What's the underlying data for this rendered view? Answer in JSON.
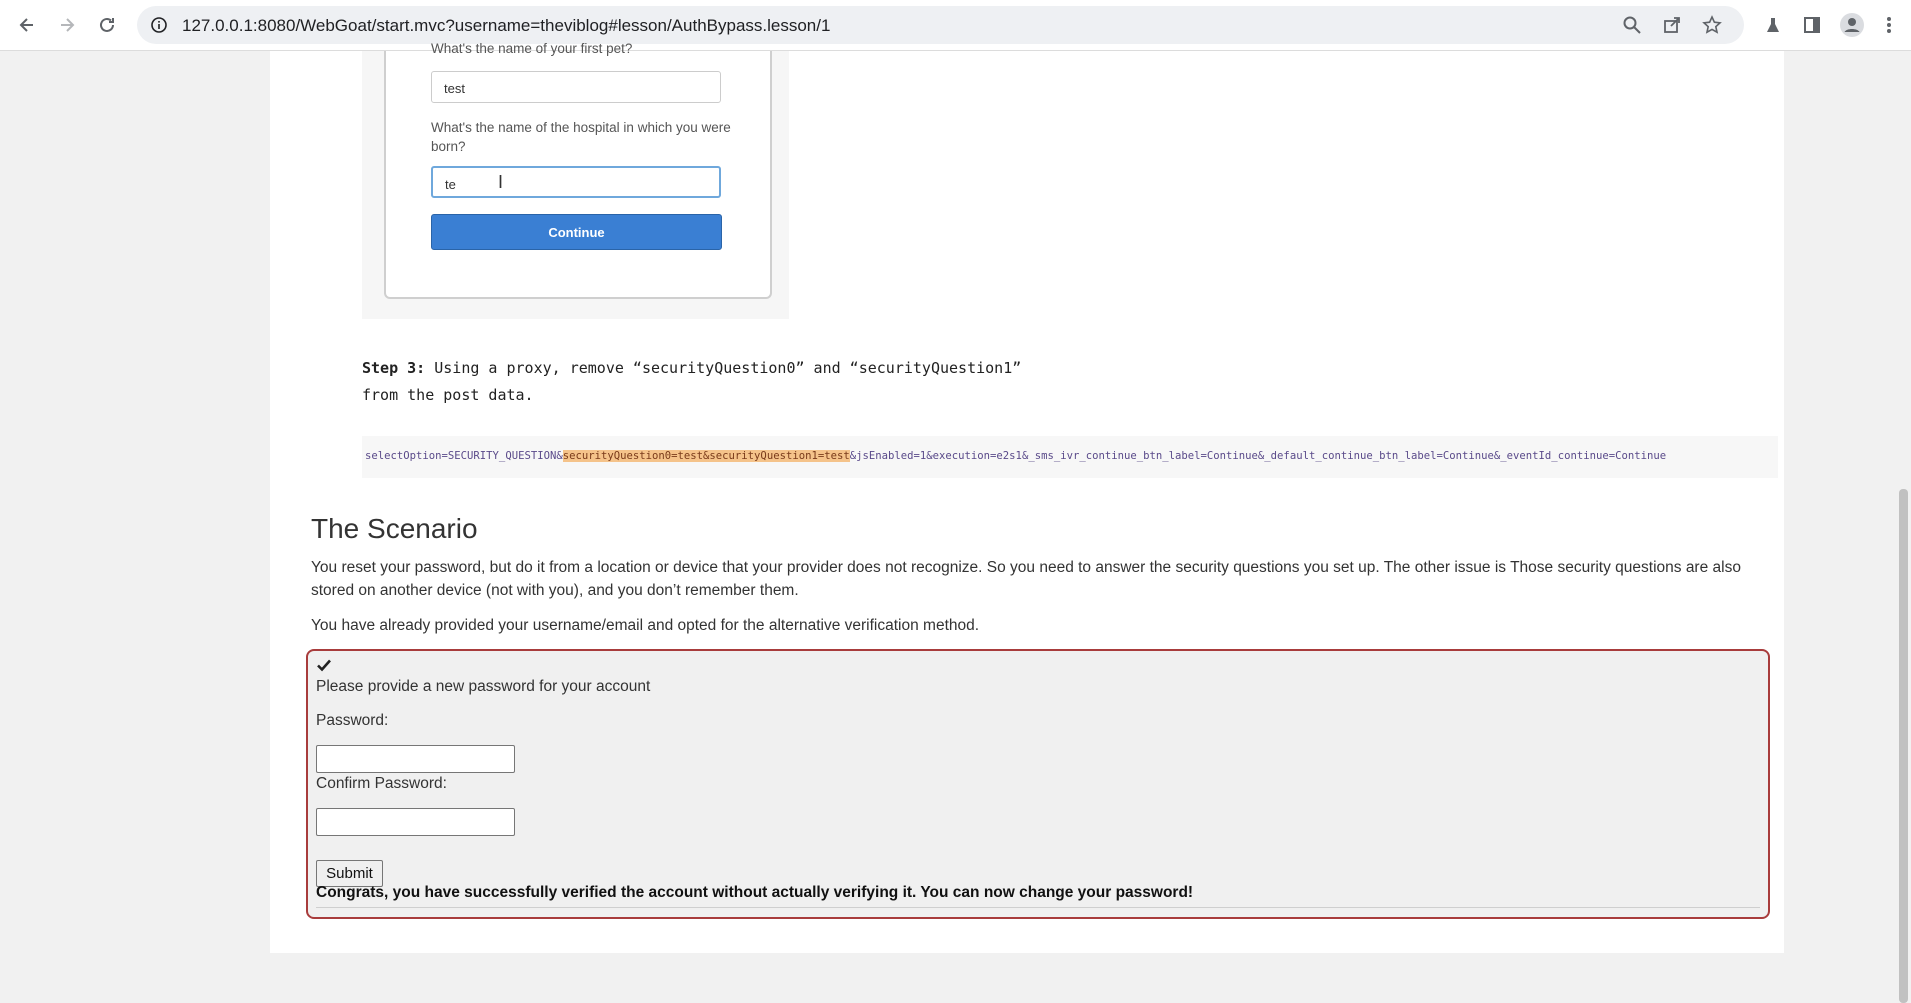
{
  "browser": {
    "url": "127.0.0.1:8080/WebGoat/start.mvc?username=theviblog#lesson/AuthBypass.lesson/1",
    "icons": [
      "back-icon",
      "forward-icon",
      "reload-icon",
      "site-info-icon",
      "zoom-icon",
      "share-icon",
      "bookmark-star-icon",
      "extension-icon",
      "side-panel-icon",
      "profile-icon",
      "menu-icon"
    ]
  },
  "screenshot_image": {
    "question1_label": "What's the name of your first pet?",
    "question1_value": "test",
    "question2_label": "What's the name of the hospital in which you were born?",
    "question2_value": "te",
    "continue_label": "Continue"
  },
  "step3": {
    "label": "Step 3:",
    "text": "Using a proxy, remove “securityQuestion0” and “securityQuestion1” from the post data."
  },
  "code": {
    "prefix": "selectOption=SECURITY_QUESTION&",
    "highlight": "securityQuestion0=test&securityQuestion1=test",
    "suffix": "&jsEnabled=1&execution=e2s1&_sms_ivr_continue_btn_label=Continue&_default_continue_btn_label=Continue&_eventId_continue=Continue"
  },
  "scenario": {
    "title": "The Scenario",
    "para1": "You reset your password, but do it from a location or device that your provider does not recognize. So you need to answer the security questions you set up. The other issue is Those security questions are also stored on another device (not with you), and you don’t remember them.",
    "para2": "You have already provided your username/email and opted for the alternative verification method."
  },
  "form": {
    "instruction": "Please provide a new password for your account",
    "password_label": "Password:",
    "confirm_label": "Confirm Password:",
    "password_value": "",
    "confirm_value": "",
    "submit_label": "Submit",
    "success_message": "Congrats, you have successfully verified the account without actually verifying it. You can now change your password!",
    "colors": {
      "panel_border": "#a83c3c",
      "panel_bg": "#f0f0f0"
    }
  }
}
